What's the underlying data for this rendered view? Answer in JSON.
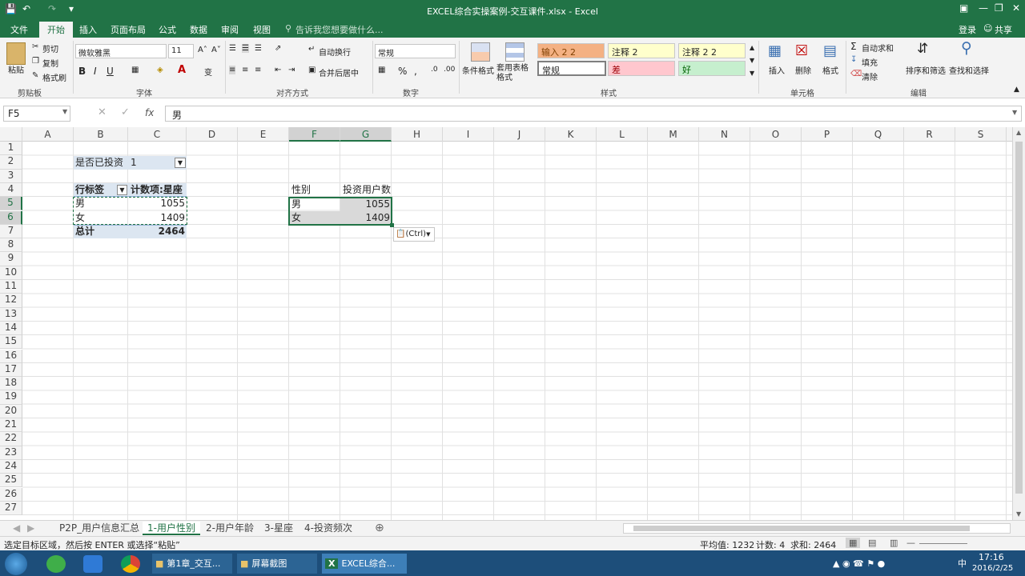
{
  "window": {
    "title": "EXCEL综合实操案例-交互课件.xlsx - Excel"
  },
  "menu": {
    "file": "文件",
    "home": "开始",
    "insert": "插入",
    "layout": "页面布局",
    "formulas": "公式",
    "data": "数据",
    "review": "审阅",
    "view": "视图",
    "tellme": "告诉我您想要做什么...",
    "login": "登录",
    "share": "共享"
  },
  "ribbon": {
    "clipboard": {
      "paste": "粘贴",
      "cut": "剪切",
      "copy": "复制",
      "painter": "格式刷",
      "group": "剪贴板"
    },
    "font": {
      "name": "微软雅黑",
      "size": "11",
      "bold": "B",
      "italic": "I",
      "underline": "U",
      "group": "字体"
    },
    "alignment": {
      "wrap": "自动换行",
      "merge": "合并后居中",
      "group": "对齐方式"
    },
    "number": {
      "format": "常规",
      "percent": "%",
      "comma": ",",
      "group": "数字"
    },
    "styles": {
      "cond": "条件格式",
      "table": "套用表格格式",
      "s1": "输入 2 2",
      "s2": "注释 2",
      "s3": "注释 2 2",
      "s4": "常规",
      "s5": "差",
      "s6": "好",
      "group": "样式"
    },
    "cells": {
      "insert": "插入",
      "delete": "删除",
      "format": "格式",
      "group": "单元格"
    },
    "editing": {
      "autosum": "自动求和",
      "fill": "填充",
      "clear": "清除",
      "sort": "排序和筛选",
      "find": "查找和选择",
      "group": "编辑"
    }
  },
  "formula": {
    "namebox": "F5",
    "fx": "fx",
    "value": "男"
  },
  "columns": [
    "A",
    "B",
    "C",
    "D",
    "E",
    "F",
    "G",
    "H",
    "I",
    "J",
    "K",
    "L",
    "M",
    "N",
    "O",
    "P",
    "Q",
    "R",
    "S"
  ],
  "rows": [
    "1",
    "2",
    "3",
    "4",
    "5",
    "6",
    "7",
    "8",
    "9",
    "10",
    "11",
    "12",
    "13",
    "14",
    "15",
    "16",
    "17",
    "18",
    "19",
    "20",
    "21",
    "22",
    "23",
    "24",
    "25",
    "26",
    "27"
  ],
  "pivot": {
    "filter_label": "是否已投资",
    "filter_value": "1",
    "hdr_row": "行标签",
    "hdr_count": "计数项:星座",
    "r1_label": "男",
    "r1_value": "1055",
    "r2_label": "女",
    "r2_value": "1409",
    "total_label": "总计",
    "total_value": "2464"
  },
  "table": {
    "hdr_gender": "性别",
    "hdr_users": "投资用户数",
    "r1_label": "男",
    "r1_value": "1055",
    "r2_label": "女",
    "r2_value": "1409"
  },
  "paste_options": "(Ctrl)",
  "sheets": [
    "P2P_用户信息汇总",
    "1-用户性别",
    "2-用户年龄",
    "3-星座",
    "4-投资频次"
  ],
  "status": {
    "message": "选定目标区域，然后按 ENTER 或选择“粘贴”",
    "average": "平均值: 1232",
    "count": "计数: 4",
    "sum": "求和: 2464"
  },
  "taskbar": {
    "item1": "第1章_交互...",
    "item2": "屏幕截图",
    "item3": "EXCEL综合...",
    "ime": "中",
    "time": "17:16",
    "date": "2016/2/25"
  },
  "colors": {
    "excel_green": "#217346",
    "selection": "#d9d9d9"
  }
}
